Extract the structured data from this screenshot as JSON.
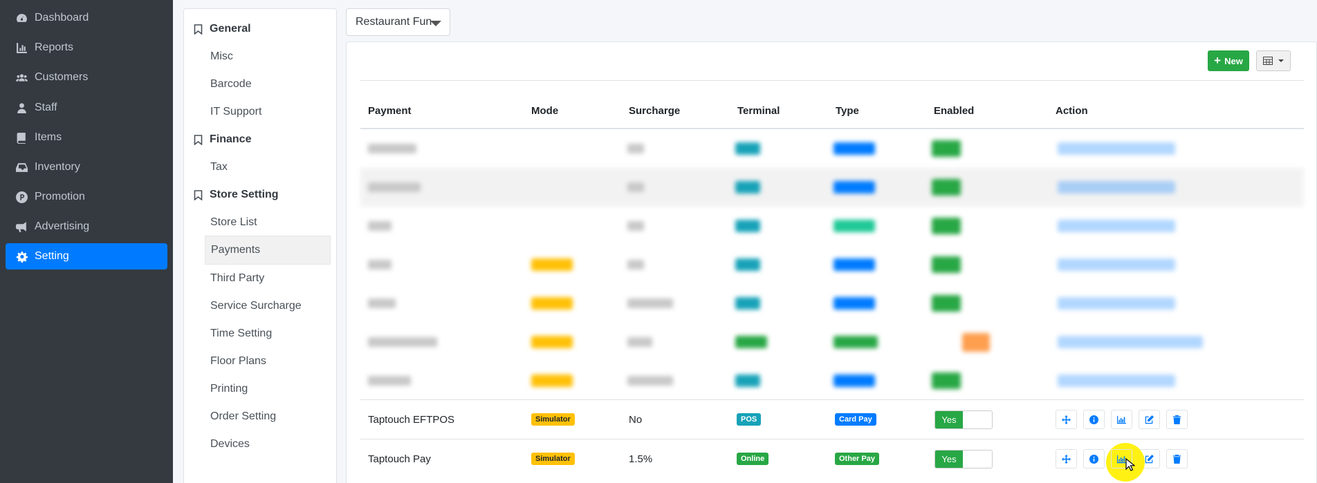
{
  "sidebar": {
    "items": [
      {
        "label": "Dashboard",
        "icon": "dashboard-icon"
      },
      {
        "label": "Reports",
        "icon": "bar-chart-icon"
      },
      {
        "label": "Customers",
        "icon": "users-icon"
      },
      {
        "label": "Staff",
        "icon": "staff-icon"
      },
      {
        "label": "Items",
        "icon": "book-icon"
      },
      {
        "label": "Inventory",
        "icon": "inbox-icon"
      },
      {
        "label": "Promotion",
        "icon": "promotion-p-icon"
      },
      {
        "label": "Advertising",
        "icon": "megaphone-icon"
      },
      {
        "label": "Setting",
        "icon": "gear-icon",
        "active": true
      }
    ]
  },
  "submenu": {
    "sections": [
      {
        "title": "General",
        "items": [
          "Misc",
          "Barcode",
          "IT Support"
        ]
      },
      {
        "title": "Finance",
        "items": [
          "Tax"
        ]
      },
      {
        "title": "Store Setting",
        "items": [
          "Store List",
          "Payments",
          "Third Party",
          "Service Surcharge",
          "Time Setting",
          "Floor Plans",
          "Printing",
          "Order Setting",
          "Devices"
        ]
      }
    ],
    "active_item": "Payments"
  },
  "store_select": {
    "value": "Restaurant Fun"
  },
  "toolbar": {
    "new_label": "New"
  },
  "table": {
    "headers": {
      "payment": "Payment",
      "mode": "Mode",
      "surcharge": "Surcharge",
      "terminal": "Terminal",
      "type": "Type",
      "enabled": "Enabled",
      "action": "Action"
    },
    "rows": [
      {
        "payment": "Taptouch EFTPOS",
        "mode": "Simulator",
        "surcharge": "No",
        "terminal": "POS",
        "type": "Card Pay",
        "enabled": "Yes"
      },
      {
        "payment": "Taptouch Pay",
        "mode": "Simulator",
        "surcharge": "1.5%",
        "terminal": "Online",
        "type": "Other Pay",
        "enabled": "Yes"
      }
    ]
  },
  "colors": {
    "primary": "#007bff",
    "success": "#28a745",
    "warning": "#ffc107",
    "info": "#17a2b8",
    "sidebar_bg": "#343a40"
  }
}
